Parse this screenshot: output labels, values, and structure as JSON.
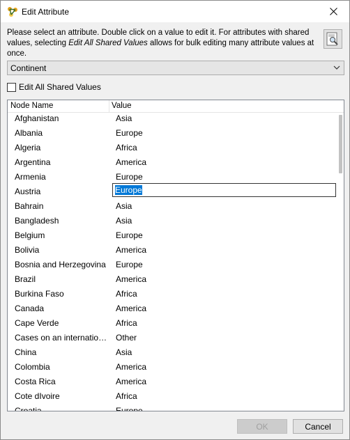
{
  "window": {
    "title": "Edit Attribute",
    "icons": {
      "app": "cytoscape-app-icon",
      "close": "close-icon",
      "help": "help-magnifier-icon"
    }
  },
  "instructions": {
    "part1": "Please select an attribute. Double click on a value to edit it. For attributes with shared values, selecting ",
    "emphasis": "Edit All Shared Values",
    "part2": " allows for bulk editing many attribute values at once."
  },
  "attribute_select": {
    "selected": "Continent"
  },
  "edit_all_shared": {
    "label": "Edit All Shared Values",
    "checked": false
  },
  "table": {
    "columns": [
      "Node Name",
      "Value"
    ],
    "rows": [
      {
        "name": "Afghanistan",
        "value": "Asia"
      },
      {
        "name": "Albania",
        "value": "Europe"
      },
      {
        "name": "Algeria",
        "value": "Africa"
      },
      {
        "name": "Argentina",
        "value": "America"
      },
      {
        "name": "Armenia",
        "value": "Europe"
      },
      {
        "name": "Austria",
        "value": "Europe"
      },
      {
        "name": "Bahrain",
        "value": "Asia"
      },
      {
        "name": "Bangladesh",
        "value": "Asia"
      },
      {
        "name": "Belgium",
        "value": "Europe"
      },
      {
        "name": "Bolivia",
        "value": "America"
      },
      {
        "name": "Bosnia and Herzegovina",
        "value": "Europe"
      },
      {
        "name": "Brazil",
        "value": "America"
      },
      {
        "name": "Burkina Faso",
        "value": "Africa"
      },
      {
        "name": "Canada",
        "value": "America"
      },
      {
        "name": "Cape Verde",
        "value": "Africa"
      },
      {
        "name": "Cases on an international...",
        "value": "Other"
      },
      {
        "name": "China",
        "value": "Asia"
      },
      {
        "name": "Colombia",
        "value": "America"
      },
      {
        "name": "Costa Rica",
        "value": "America"
      },
      {
        "name": "Cote dIvoire",
        "value": "Africa"
      },
      {
        "name": "Croatia",
        "value": "Europe"
      }
    ],
    "editing_row_index": 5
  },
  "buttons": {
    "ok": "OK",
    "cancel": "Cancel"
  },
  "colors": {
    "selection": "#0078d7",
    "disabled_text": "#a0a0a0"
  }
}
